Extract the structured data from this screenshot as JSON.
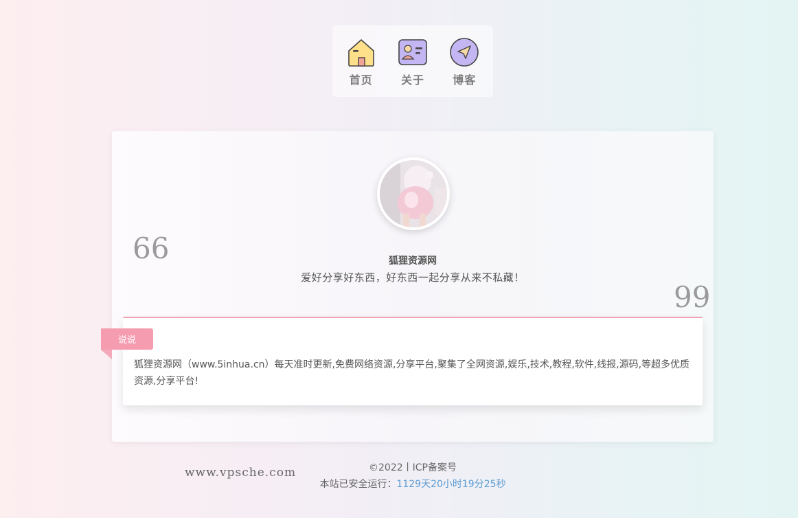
{
  "nav": {
    "items": [
      {
        "label": "首页",
        "icon": "home-icon"
      },
      {
        "label": "关于",
        "icon": "id-card-icon"
      },
      {
        "label": "博客",
        "icon": "send-icon"
      }
    ]
  },
  "profile": {
    "avatar": "avatar-photo",
    "name": "狐狸资源网",
    "motto": "爱好分享好东西，好东西一起分享从来不私藏！"
  },
  "quotes": {
    "open": "66",
    "close": "99"
  },
  "shuoshuo": {
    "tag": "说说",
    "text": "狐狸资源网（www.5inhua.cn）每天准时更新,免费网络资源,分享平台,聚集了全网资源,娱乐,技术,教程,软件,线报,源码,等超多优质资源,分享平台!"
  },
  "footer": {
    "watermark": "www.vpsche.com",
    "copyright": "©2022丨ICP备案号",
    "uptime_label": "本站已安全运行：",
    "uptime_value": "1129天20小时19分25秒"
  },
  "colors": {
    "accent_pink": "#f59cb0",
    "uptime_blue": "#5b9bd0"
  }
}
